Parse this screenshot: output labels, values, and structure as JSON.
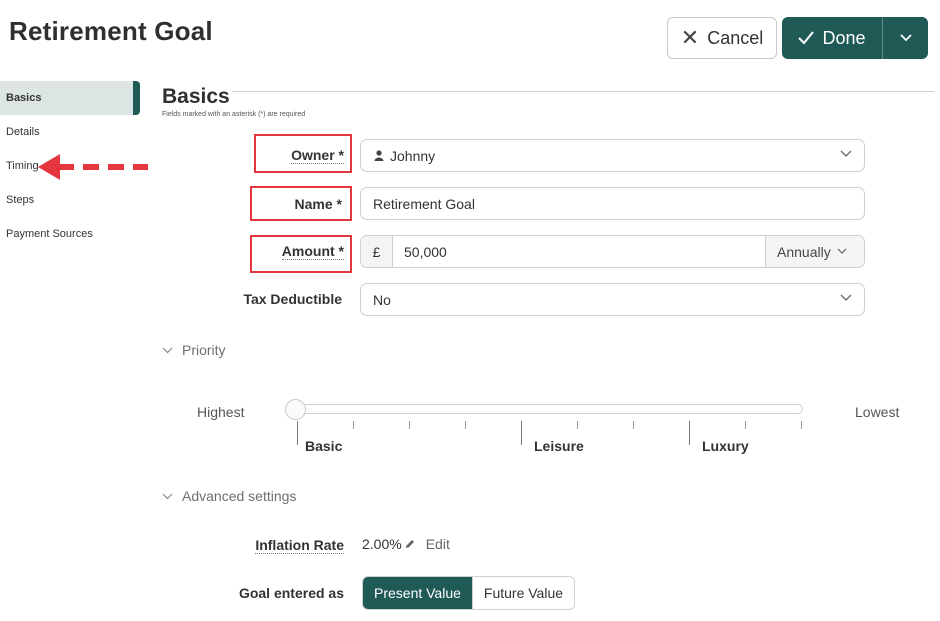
{
  "header": {
    "title": "Retirement Goal",
    "cancel_label": "Cancel",
    "done_label": "Done"
  },
  "sidebar": {
    "items": [
      {
        "label": "Basics",
        "active": true
      },
      {
        "label": "Details"
      },
      {
        "label": "Timing"
      },
      {
        "label": "Steps"
      },
      {
        "label": "Payment Sources"
      }
    ]
  },
  "section": {
    "title": "Basics",
    "required_note": "Fields marked with an asterisk (*) are required"
  },
  "form": {
    "owner": {
      "label": "Owner *",
      "value": "Johnny"
    },
    "name": {
      "label": "Name *",
      "value": "Retirement Goal"
    },
    "amount": {
      "label": "Amount *",
      "currency": "£",
      "value": "50,000",
      "frequency": "Annually"
    },
    "tax": {
      "label": "Tax Deductible",
      "value": "No"
    }
  },
  "priority": {
    "heading": "Priority",
    "left_label": "Highest",
    "right_label": "Lowest",
    "ticks": [
      "Basic",
      "Leisure",
      "Luxury"
    ],
    "level": 0
  },
  "advanced": {
    "heading": "Advanced settings",
    "inflation_label": "Inflation Rate",
    "inflation_value": "2.00%",
    "edit_label": "Edit",
    "entered_label": "Goal entered as",
    "options": [
      "Present Value",
      "Future Value"
    ],
    "selected": "Present Value"
  },
  "colors": {
    "accent": "#1f5a57",
    "annotation": "#e4363e"
  }
}
